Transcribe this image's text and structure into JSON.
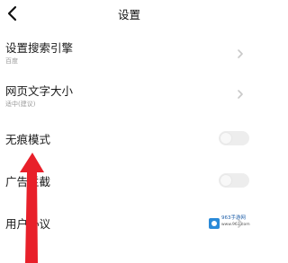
{
  "header": {
    "title": "设置"
  },
  "settings": {
    "search_engine": {
      "label": "设置搜索引擎",
      "value": "百度"
    },
    "font_size": {
      "label": "网页文字大小",
      "value": "适中(建议)"
    },
    "incognito": {
      "label": "无痕模式",
      "enabled": false
    },
    "ad_block": {
      "label": "广告拦截",
      "enabled": false
    },
    "user_agreement": {
      "label": "用户协议"
    }
  },
  "watermark": {
    "name": "963手游网",
    "url": "www.963.com"
  },
  "colors": {
    "arrow": "#e8202a",
    "toggle_off": "#ededed",
    "watermark_blue": "#2a8ad8"
  }
}
